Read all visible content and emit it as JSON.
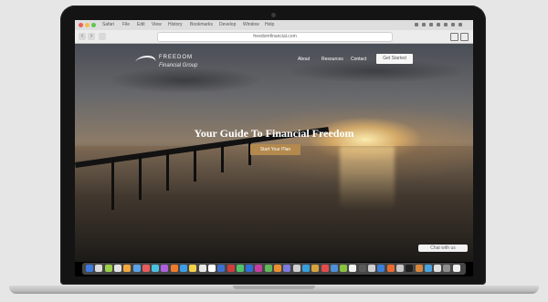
{
  "browser": {
    "menu_items": [
      "Safari",
      "File",
      "Edit",
      "View",
      "History",
      "Bookmarks",
      "Develop",
      "Window",
      "Help"
    ],
    "url": "freedomfinancial.com"
  },
  "site": {
    "logo_name": "FREEDOM",
    "logo_script": "Financial Group",
    "nav": [
      "About",
      "Resources",
      "Contact"
    ],
    "nav_cta": "Get Started",
    "hero_title": "Your Guide To Financial Freedom",
    "hero_button": "Start Your Plan",
    "chat_label": "Chat with us"
  },
  "dock": {
    "icon_colors": [
      "#3d7be0",
      "#dcdcdc",
      "#9ad04b",
      "#e3e3e3",
      "#f2a93b",
      "#5aa3ea",
      "#e85c5c",
      "#4ac0e0",
      "#b05ee0",
      "#f07c2b",
      "#3c9ee8",
      "#f5d04a",
      "#e8e8e8",
      "#ffffff",
      "#3b71cf",
      "#d13b3b",
      "#4fc46b",
      "#2c6fd6",
      "#c73ca0",
      "#5fb85a",
      "#ed8f2d",
      "#7a7ae0",
      "#cfcfcf",
      "#35a0dd",
      "#d8a23a",
      "#e64a4a",
      "#4d8fd8",
      "#89c23f",
      "#f3f3f3",
      "#5a5a5a",
      "#d0d0d0",
      "#3a7fd8",
      "#eb6b2f",
      "#c9c9c9",
      "#1f1f1f",
      "#d7863d",
      "#4aa3df",
      "#e0e0e0",
      "#8e8e8e",
      "#efefef"
    ]
  }
}
